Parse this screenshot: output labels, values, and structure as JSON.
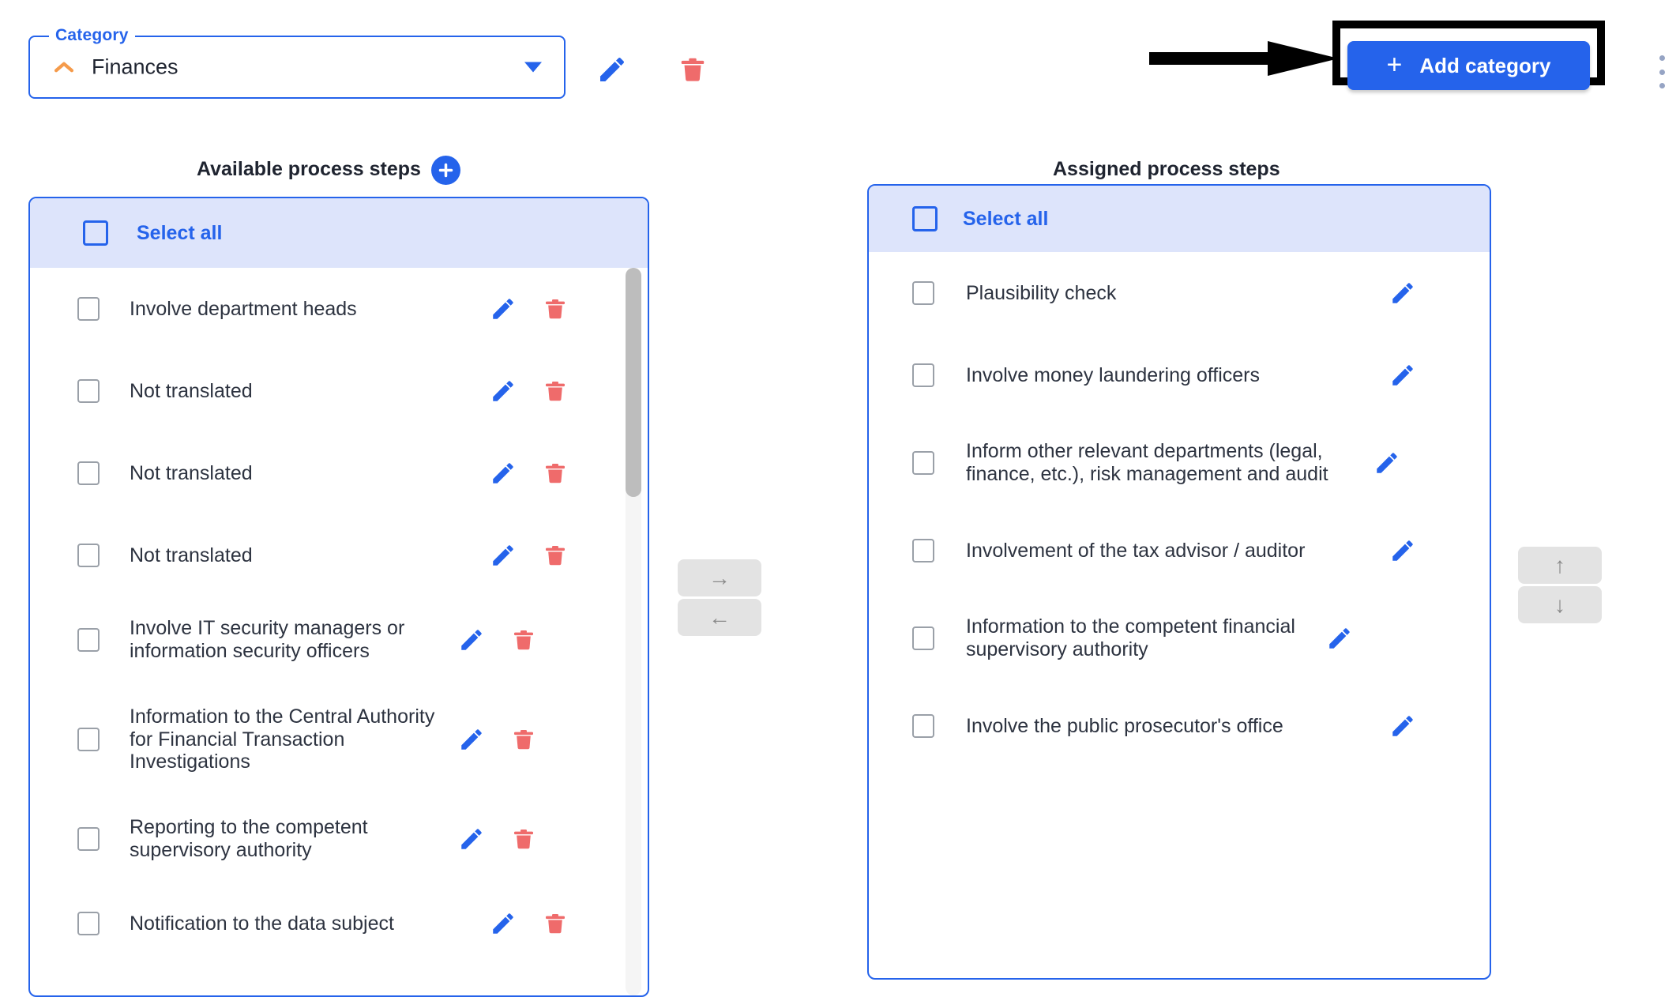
{
  "category": {
    "legend": "Category",
    "value": "Finances",
    "chevron_icon": "chevron-up-icon",
    "caret_icon": "chevron-down-icon",
    "edit_icon": "pencil-icon",
    "delete_icon": "trash-icon",
    "accent_color": "#2563eb",
    "chevron_color": "#f59b4b",
    "delete_color": "#ef6b6b"
  },
  "toolbar": {
    "add_category_label": "Add category",
    "add_category_plus": "+",
    "kebab_icon": "kebab-menu-icon",
    "annotation": {
      "arrow_icon": "arrow-right-annotation",
      "box_color": "#000000"
    }
  },
  "available": {
    "title": "Available process steps",
    "add_icon": "plus-icon",
    "select_all_label": "Select all",
    "items": [
      {
        "label": "Involve department heads",
        "checked": false,
        "edit_icon": "pencil-icon",
        "delete_icon": "trash-icon"
      },
      {
        "label": "Not translated",
        "checked": false,
        "edit_icon": "pencil-icon",
        "delete_icon": "trash-icon"
      },
      {
        "label": "Not translated",
        "checked": false,
        "edit_icon": "pencil-icon",
        "delete_icon": "trash-icon"
      },
      {
        "label": "Not translated",
        "checked": false,
        "edit_icon": "pencil-icon",
        "delete_icon": "trash-icon"
      },
      {
        "label": "Involve IT security managers or information security officers",
        "checked": false,
        "edit_icon": "pencil-icon",
        "delete_icon": "trash-icon"
      },
      {
        "label": "Information to the Central Authority for Financial Transaction Investigations",
        "checked": false,
        "edit_icon": "pencil-icon",
        "delete_icon": "trash-icon"
      },
      {
        "label": "Reporting to the competent supervisory authority",
        "checked": false,
        "edit_icon": "pencil-icon",
        "delete_icon": "trash-icon"
      },
      {
        "label": "Notification to the data subject",
        "checked": false,
        "edit_icon": "pencil-icon",
        "delete_icon": "trash-icon"
      }
    ]
  },
  "assigned": {
    "title": "Assigned process steps",
    "select_all_label": "Select all",
    "items": [
      {
        "label": "Plausibility check",
        "checked": false,
        "edit_icon": "pencil-icon"
      },
      {
        "label": "Involve money laundering officers",
        "checked": false,
        "edit_icon": "pencil-icon"
      },
      {
        "label": "Inform other relevant departments (legal, finance, etc.), risk management and audit",
        "checked": false,
        "edit_icon": "pencil-icon"
      },
      {
        "label": "Involvement of the tax advisor / auditor",
        "checked": false,
        "edit_icon": "pencil-icon"
      },
      {
        "label": "Information to the competent financial supervisory authority",
        "checked": false,
        "edit_icon": "pencil-icon"
      },
      {
        "label": "Involve the public prosecutor's office",
        "checked": false,
        "edit_icon": "pencil-icon"
      }
    ]
  },
  "transfer": {
    "move_right": "→",
    "move_left": "←",
    "move_up": "↑",
    "move_down": "↓"
  }
}
